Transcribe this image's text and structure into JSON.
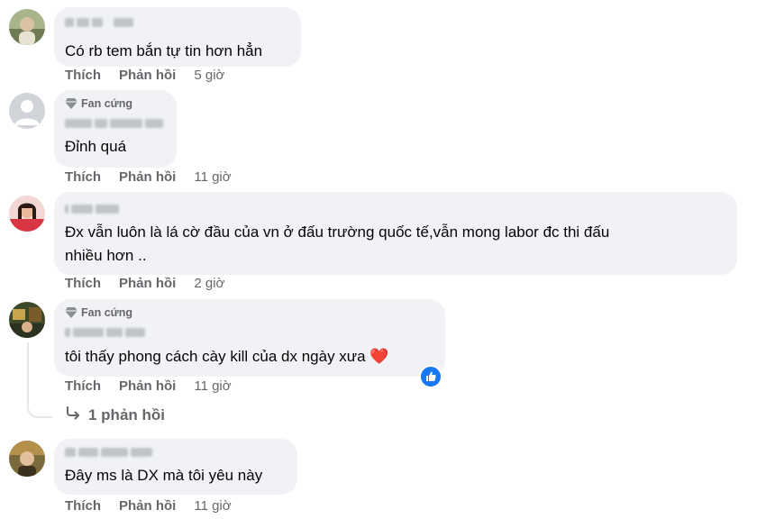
{
  "comments": [
    {
      "text_lines": [
        "Có rb tem bắn tự tin hơn hẳn"
      ],
      "badge": "",
      "actions": {
        "like": "Thích",
        "reply": "Phản hồi",
        "time": "5 giờ"
      }
    },
    {
      "text_lines": [
        "Đỉnh quá"
      ],
      "badge": "Fan cứng",
      "actions": {
        "like": "Thích",
        "reply": "Phản hồi",
        "time": "11 giờ"
      }
    },
    {
      "text_lines": [
        "Đx vẫn luôn là lá cờ đầu của vn ở đấu trường quốc tế,vẫn mong labor đc thi đấu",
        "nhiều hơn .."
      ],
      "badge": "",
      "actions": {
        "like": "Thích",
        "reply": "Phản hồi",
        "time": "2 giờ"
      }
    },
    {
      "text_lines": [
        "tôi thấy phong cách cày kill của dx ngày xưa ❤️"
      ],
      "badge": "Fan cứng",
      "actions": {
        "like": "Thích",
        "reply": "Phản hồi",
        "time": "11 giờ"
      },
      "view_replies": "1 phản hồi"
    },
    {
      "text_lines": [
        "Đây ms là DX mà tôi yêu này"
      ],
      "badge": "",
      "actions": {
        "like": "Thích",
        "reply": "Phản hồi",
        "time": "11 giờ"
      }
    }
  ],
  "icons": {
    "fan_badge": "diamond-icon",
    "reaction": "like-reaction-icon",
    "reply_arrow": "reply-arrow-icon"
  },
  "colors": {
    "bubble": "#f0f2f5",
    "secondary_text": "#65676b",
    "like_blue": "#1877f2",
    "heart": "#e41e3f"
  }
}
